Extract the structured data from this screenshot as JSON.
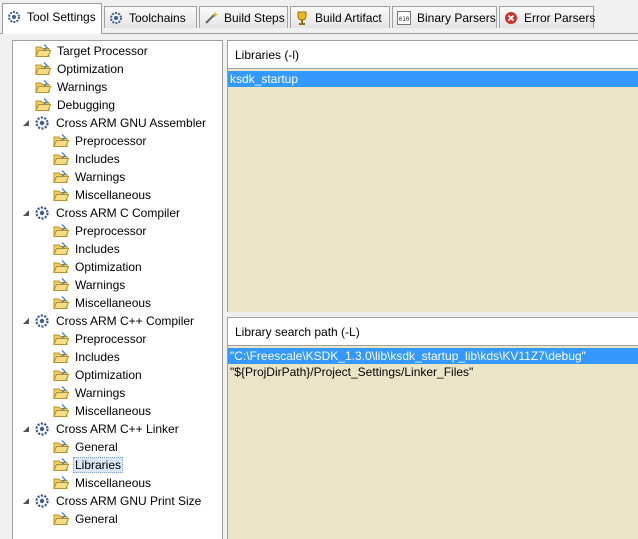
{
  "tabs": [
    {
      "label": "Tool Settings",
      "icon": "gear-icon",
      "active": true
    },
    {
      "label": "Toolchains",
      "icon": "gear-icon",
      "active": false
    },
    {
      "label": "Build Steps",
      "icon": "wand-icon",
      "active": false
    },
    {
      "label": "Build Artifact",
      "icon": "trophy-icon",
      "active": false
    },
    {
      "label": "Binary Parsers",
      "icon": "binary-icon",
      "active": false
    },
    {
      "label": "Error Parsers",
      "icon": "error-icon",
      "active": false
    }
  ],
  "tree": [
    {
      "label": "Target Processor",
      "level": 1
    },
    {
      "label": "Optimization",
      "level": 1
    },
    {
      "label": "Warnings",
      "level": 1
    },
    {
      "label": "Debugging",
      "level": 1
    },
    {
      "label": "Cross ARM GNU Assembler",
      "level": 0
    },
    {
      "label": "Preprocessor",
      "level": 2
    },
    {
      "label": "Includes",
      "level": 2
    },
    {
      "label": "Warnings",
      "level": 2
    },
    {
      "label": "Miscellaneous",
      "level": 2
    },
    {
      "label": "Cross ARM C Compiler",
      "level": 0
    },
    {
      "label": "Preprocessor",
      "level": 2
    },
    {
      "label": "Includes",
      "level": 2
    },
    {
      "label": "Optimization",
      "level": 2
    },
    {
      "label": "Warnings",
      "level": 2
    },
    {
      "label": "Miscellaneous",
      "level": 2
    },
    {
      "label": "Cross ARM C++ Compiler",
      "level": 0
    },
    {
      "label": "Preprocessor",
      "level": 2
    },
    {
      "label": "Includes",
      "level": 2
    },
    {
      "label": "Optimization",
      "level": 2
    },
    {
      "label": "Warnings",
      "level": 2
    },
    {
      "label": "Miscellaneous",
      "level": 2
    },
    {
      "label": "Cross ARM C++ Linker",
      "level": 0
    },
    {
      "label": "General",
      "level": 2
    },
    {
      "label": "Libraries",
      "level": 2,
      "selected": true
    },
    {
      "label": "Miscellaneous",
      "level": 2
    },
    {
      "label": "Cross ARM GNU Print Size",
      "level": 0
    },
    {
      "label": "General",
      "level": 2
    }
  ],
  "libraries": {
    "title": "Libraries (-l)",
    "items": [
      {
        "value": "ksdk_startup",
        "selected": true
      }
    ]
  },
  "search_path": {
    "title": "Library search path (-L)",
    "items": [
      {
        "value": "\"C:\\Freescale\\KSDK_1.3.0\\lib\\ksdk_startup_lib\\kds\\KV11Z7\\debug\"",
        "selected": true
      },
      {
        "value": "\"${ProjDirPath}/Project_Settings/Linker_Files\"",
        "selected": false
      }
    ]
  },
  "colors": {
    "selection": "#3399ff",
    "list_background": "#ebe5c7",
    "tree_selection": "#dbe8fa"
  }
}
